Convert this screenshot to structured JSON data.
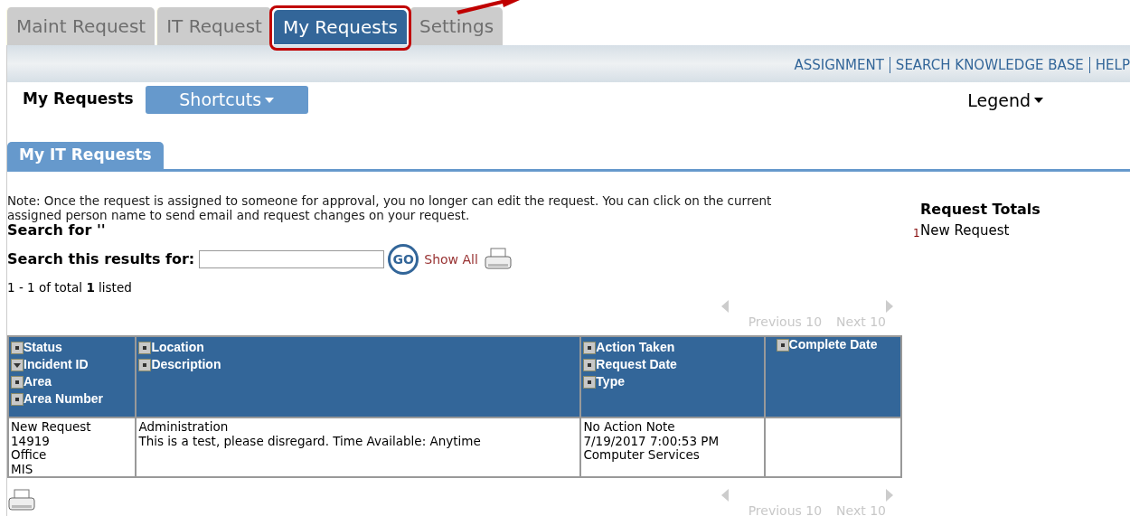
{
  "tabs": [
    {
      "label": "Maint Request",
      "selected": false
    },
    {
      "label": "IT Request",
      "selected": false
    },
    {
      "label": "My Requests",
      "selected": true
    },
    {
      "label": "Settings",
      "selected": false
    }
  ],
  "top_links": [
    "ASSIGNMENT",
    "SEARCH KNOWLEDGE BASE",
    "HELP"
  ],
  "page_title": "My Requests",
  "shortcuts_button": "Shortcuts",
  "legend_button": "Legend",
  "section_tab": "My IT Requests",
  "note": "Note: Once the request is assigned to someone for approval, you no longer can edit the request. You can click on the current assigned person name to send email and request changes on your request.",
  "search_for": "Search for ''",
  "search_label": "Search this results for:",
  "go_button": "GO",
  "show_all": "Show All",
  "listed": "1 - 1 of total **1** listed",
  "pager_top": {
    "previous": "Previous 10",
    "next": "Next 10"
  },
  "pager_bottom": {
    "previous": "Previous 10",
    "next": "Next 10"
  },
  "table": {
    "header_groups": [
      {
        "fields": [
          {
            "label": "Status",
            "sorted": false
          },
          {
            "label": "Incident ID",
            "sorted": true
          },
          {
            "label": "Area",
            "sorted": false
          },
          {
            "label": "Area Number",
            "sorted": false
          }
        ]
      },
      {
        "fields": [
          {
            "label": "Location",
            "sorted": false
          },
          {
            "label": "Description",
            "sorted": false
          }
        ]
      },
      {
        "fields": [
          {
            "label": "Action Taken",
            "sorted": false
          },
          {
            "label": "Request Date",
            "sorted": false
          },
          {
            "label": "Type",
            "sorted": false
          }
        ]
      },
      {
        "fields": [
          {
            "label": "Complete Date",
            "sorted": false
          }
        ]
      }
    ],
    "records": [
      {
        "cells": [
          {
            "lines": [
              "New Request",
              "14919",
              "Office",
              "MIS"
            ]
          },
          {
            "lines": [
              "Administration",
              "This is a test, please disregard. Time Available: Anytime"
            ]
          },
          {
            "lines": [
              "No Action Note",
              "7/19/2017 7:00:53 PM",
              "Computer Services"
            ]
          },
          {}
        ]
      }
    ]
  },
  "request_totals": {
    "title": "Request Totals",
    "items": [
      {
        "count": "1",
        "label": "New Request"
      }
    ]
  }
}
